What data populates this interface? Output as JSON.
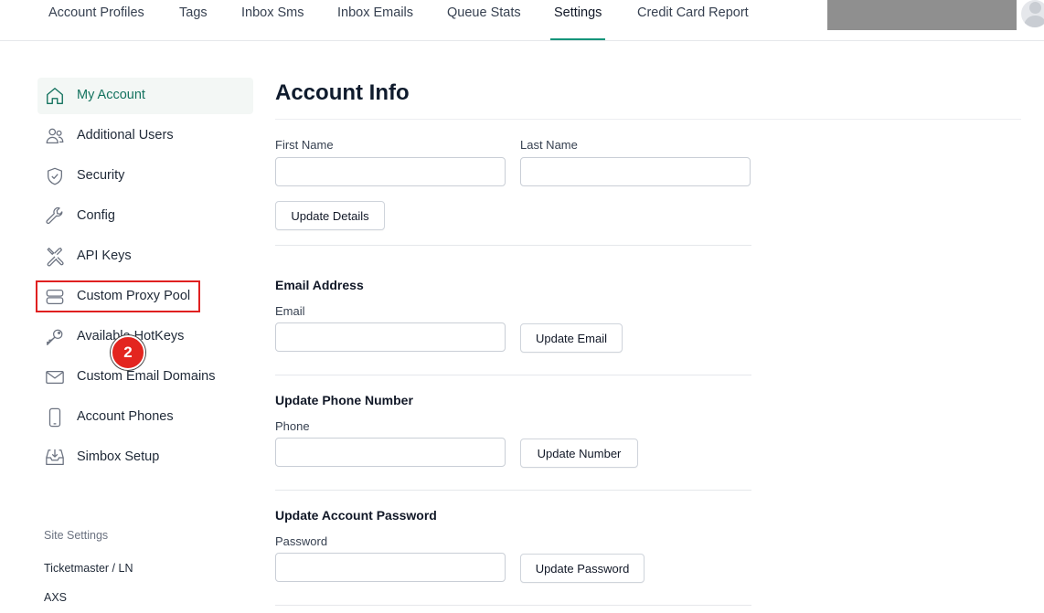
{
  "nav": {
    "tabs": [
      {
        "label": "Account Profiles"
      },
      {
        "label": "Tags"
      },
      {
        "label": "Inbox Sms"
      },
      {
        "label": "Inbox Emails"
      },
      {
        "label": "Queue Stats"
      },
      {
        "label": "Settings",
        "active": true
      },
      {
        "label": "Credit Card Report"
      }
    ]
  },
  "sidebar": {
    "items": [
      {
        "label": "My Account",
        "icon": "home-icon",
        "active": true
      },
      {
        "label": "Additional Users",
        "icon": "users-icon"
      },
      {
        "label": "Security",
        "icon": "shield-check-icon"
      },
      {
        "label": "Config",
        "icon": "wrench-icon"
      },
      {
        "label": "API Keys",
        "icon": "tools-icon"
      },
      {
        "label": "Custom Proxy Pool",
        "icon": "server-icon"
      },
      {
        "label": "Available HotKeys",
        "icon": "key-icon"
      },
      {
        "label": "Custom Email Domains",
        "icon": "mail-icon"
      },
      {
        "label": "Account Phones",
        "icon": "phone-icon"
      },
      {
        "label": "Simbox Setup",
        "icon": "inbox-download-icon"
      }
    ],
    "site_settings": {
      "heading": "Site Settings",
      "links": [
        "Ticketmaster / LN",
        "AXS"
      ]
    }
  },
  "annotation": {
    "step": "2"
  },
  "main": {
    "title": "Account Info",
    "details": {
      "first_name_label": "First Name",
      "first_name_value": "",
      "last_name_label": "Last Name",
      "last_name_value": "",
      "button": "Update Details"
    },
    "email": {
      "title": "Email Address",
      "label": "Email",
      "value": "",
      "button": "Update Email"
    },
    "phone": {
      "title": "Update Phone Number",
      "label": "Phone",
      "value": "",
      "button": "Update Number"
    },
    "password": {
      "title": "Update Account Password",
      "label": "Password",
      "value": "",
      "button": "Update Password"
    }
  },
  "colors": {
    "accent": "#14957a",
    "highlight": "#e02020"
  }
}
